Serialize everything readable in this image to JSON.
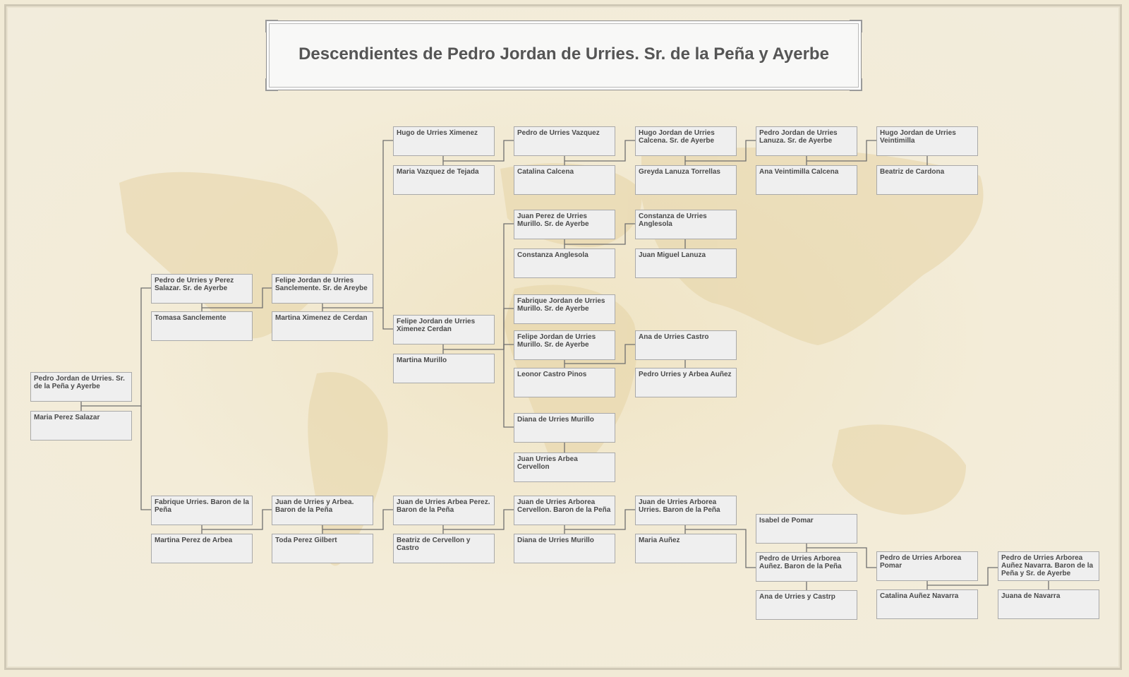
{
  "title": "Descendientes de Pedro Jordan de Urries. Sr. de la Peña y Ayerbe",
  "colors": {
    "node_fill": "#efefef",
    "node_border": "#a9a9a9",
    "line": "#6f6f6f",
    "background": "#f1ead6"
  },
  "nodes": {
    "c0_a": "Pedro Jordan de Urries. Sr. de la Peña y Ayerbe",
    "c0_b": "Maria Perez Salazar",
    "c1u_a": "Pedro de Urries y Perez Salazar. Sr. de Ayerbe",
    "c1u_b": "Tomasa Sanclemente",
    "c1l_a": "Fabrique Urries. Baron de la Peña",
    "c1l_b": "Martina Perez de Arbea",
    "c2u_a": "Felipe Jordan de Urries Sanclemente. Sr. de Areybe",
    "c2u_b": "Martina Ximenez de Cerdan",
    "c2l_a": "Juan de Urries y Arbea. Baron de la Peña",
    "c2l_b": "Toda Perez Gilbert",
    "c3t_a": "Hugo de Urries Ximenez",
    "c3t_b": "Maria Vazquez de Tejada",
    "c3m_a": "Felipe Jordan de Urries Ximenez Cerdan",
    "c3m_b": "Martina Murillo",
    "c3l_a": "Juan de Urries Arbea Perez. Baron de la Peña",
    "c3l_b": "Beatriz de Cervellon y Castro",
    "c4t_a": "Pedro de Urries Vazquez",
    "c4t_b": "Catalina Calcena",
    "c4m1_a": "Juan Perez de Urries Murillo. Sr. de Ayerbe",
    "c4m1_b": "Constanza Anglesola",
    "c4m2_a": "Fabrique Jordan de Urries Murillo. Sr. de Ayerbe",
    "c4m3_a": "Felipe Jordan de Urries Murillo. Sr. de Ayerbe",
    "c4m3_b": "Leonor Castro Pinos",
    "c4m4_a": "Diana de Urries Murillo",
    "c4m4_b": "Juan Urries Arbea Cervellon",
    "c4l_a": "Juan de Urries Arborea Cervellon. Baron de la Peña",
    "c4l_b": "Diana de Urries Murillo",
    "c5t_a": "Hugo Jordan de Urries Calcena. Sr. de Ayerbe",
    "c5t_b": "Greyda Lanuza Torrellas",
    "c5m1_a": "Constanza de Urries Anglesola",
    "c5m1_b": "Juan Miguel Lanuza",
    "c5m3_a": "Ana de Urries Castro",
    "c5m3_b": "Pedro Urries y Arbea Auñez",
    "c5l_a": "Juan de Urries Arborea Urries. Baron de la Peña",
    "c5l_b": "Maria Auñez",
    "c6t_a": "Pedro Jordan de Urries Lanuza. Sr. de Ayerbe",
    "c6t_b": "Ana Veintimilla Calcena",
    "c6l_a": "Isabel de Pomar",
    "c6l_b": "Pedro de Urries Arborea Auñez. Baron de la Peña",
    "c6l_c": "Ana de Urries y Castrp",
    "c7t_a": "Hugo Jordan de Urries Veintimilla",
    "c7t_b": "Beatriz de Cardona",
    "c7l_a": "Pedro de Urries Arborea Pomar",
    "c7l_b": "Catalina Auñez Navarra",
    "c8l_a": "Pedro de Urries Arborea Auñez Navarra. Baron de la Peña y Sr. de Ayerbe",
    "c8l_b": "Juana de Navarra"
  }
}
